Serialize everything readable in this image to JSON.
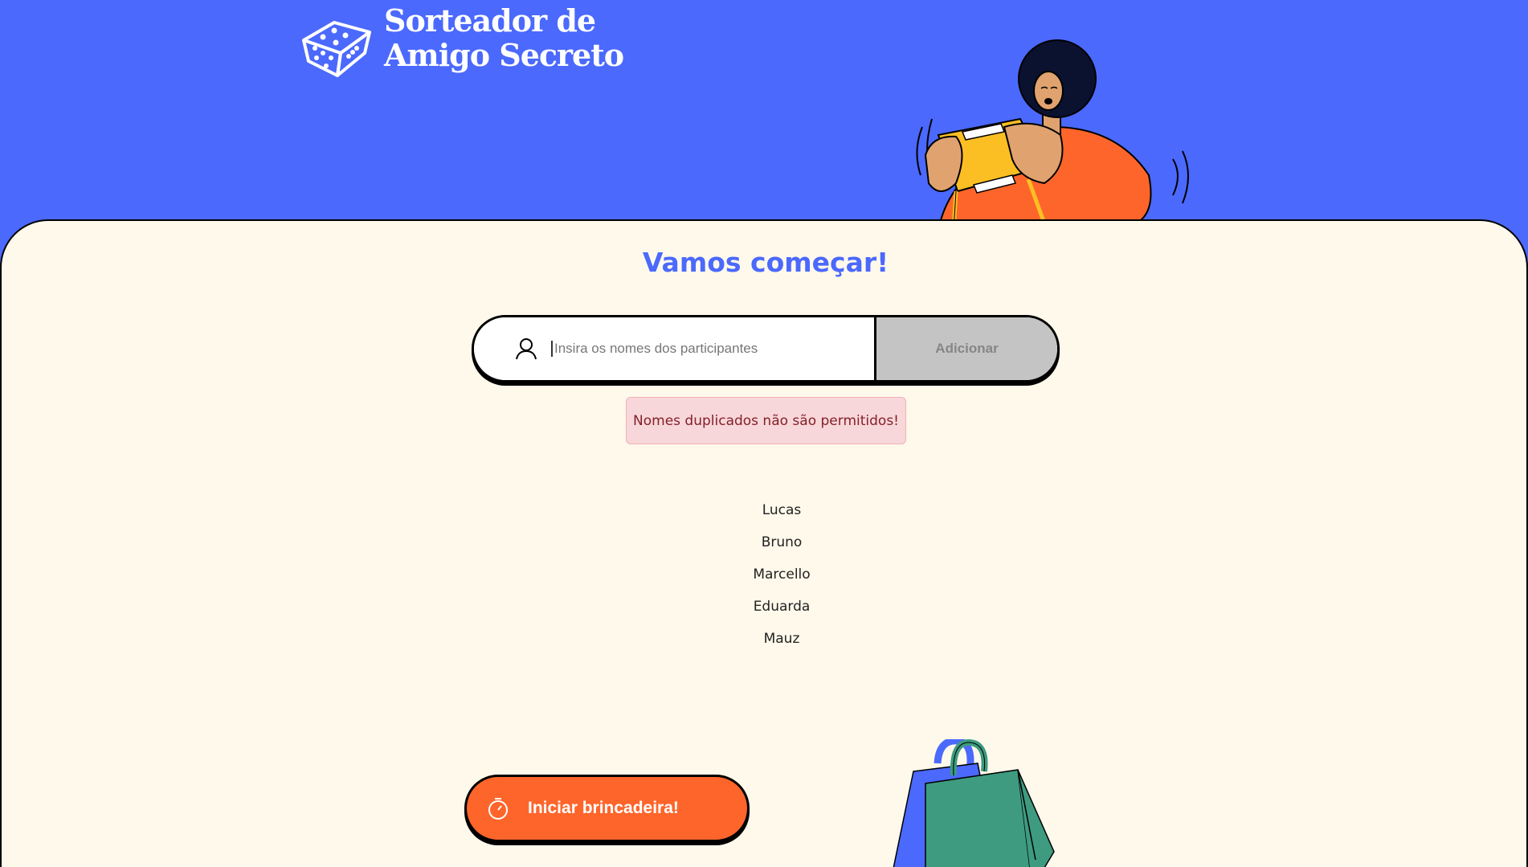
{
  "header": {
    "logo_line1": "Sorteador de",
    "logo_line2": "Amigo Secreto",
    "logo_icon": "dice-icon"
  },
  "main": {
    "title": "Vamos começar!",
    "input": {
      "placeholder": "Insira os nomes dos participantes",
      "value": "",
      "icon": "user-icon"
    },
    "add_button_label": "Adicionar",
    "alert_message": "Nomes duplicados não são permitidos!",
    "participants": [
      "Lucas",
      "Bruno",
      "Marcello",
      "Eduarda",
      "Mauz"
    ],
    "start_button_label": "Iniciar brincadeira!",
    "start_button_icon": "timer-icon"
  },
  "colors": {
    "brand_blue": "#4b69fd",
    "panel_bg": "#fff9eb",
    "accent_orange": "#fe652b",
    "disabled_gray": "#c4c4c4",
    "alert_bg": "#f8d7da",
    "alert_text": "#842029"
  }
}
